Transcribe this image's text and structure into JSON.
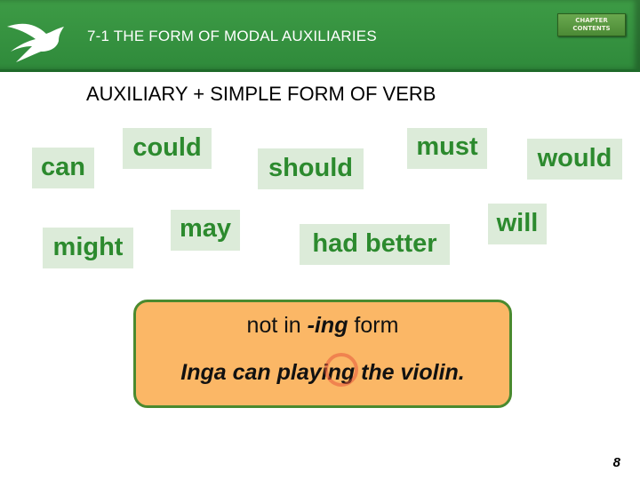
{
  "header": {
    "title": "7-1 THE FORM OF MODAL AUXILIARIES",
    "chapter_button": {
      "line1": "CHAPTER",
      "line2": "CONTENTS"
    },
    "logo_icon": "swallow-bird-icon"
  },
  "subtitle": "AUXILIARY + SIMPLE FORM OF VERB",
  "modals": [
    {
      "label": "can"
    },
    {
      "label": "could"
    },
    {
      "label": "should"
    },
    {
      "label": "must"
    },
    {
      "label": "would"
    },
    {
      "label": "might"
    },
    {
      "label": "may"
    },
    {
      "label": "had better"
    },
    {
      "label": "will"
    }
  ],
  "rule": {
    "prefix": "not in ",
    "emphasis": "-ing",
    "suffix": " form",
    "example": "Inga can playing the violin.",
    "error_mark_icon": "error-circle-icon"
  },
  "page_number": "8",
  "colors": {
    "header_green": "#33903e",
    "word_text": "#2c8a2e",
    "word_bg": "#dcebd9",
    "rule_bg": "#fbb766",
    "rule_border": "#4a8a2f"
  }
}
